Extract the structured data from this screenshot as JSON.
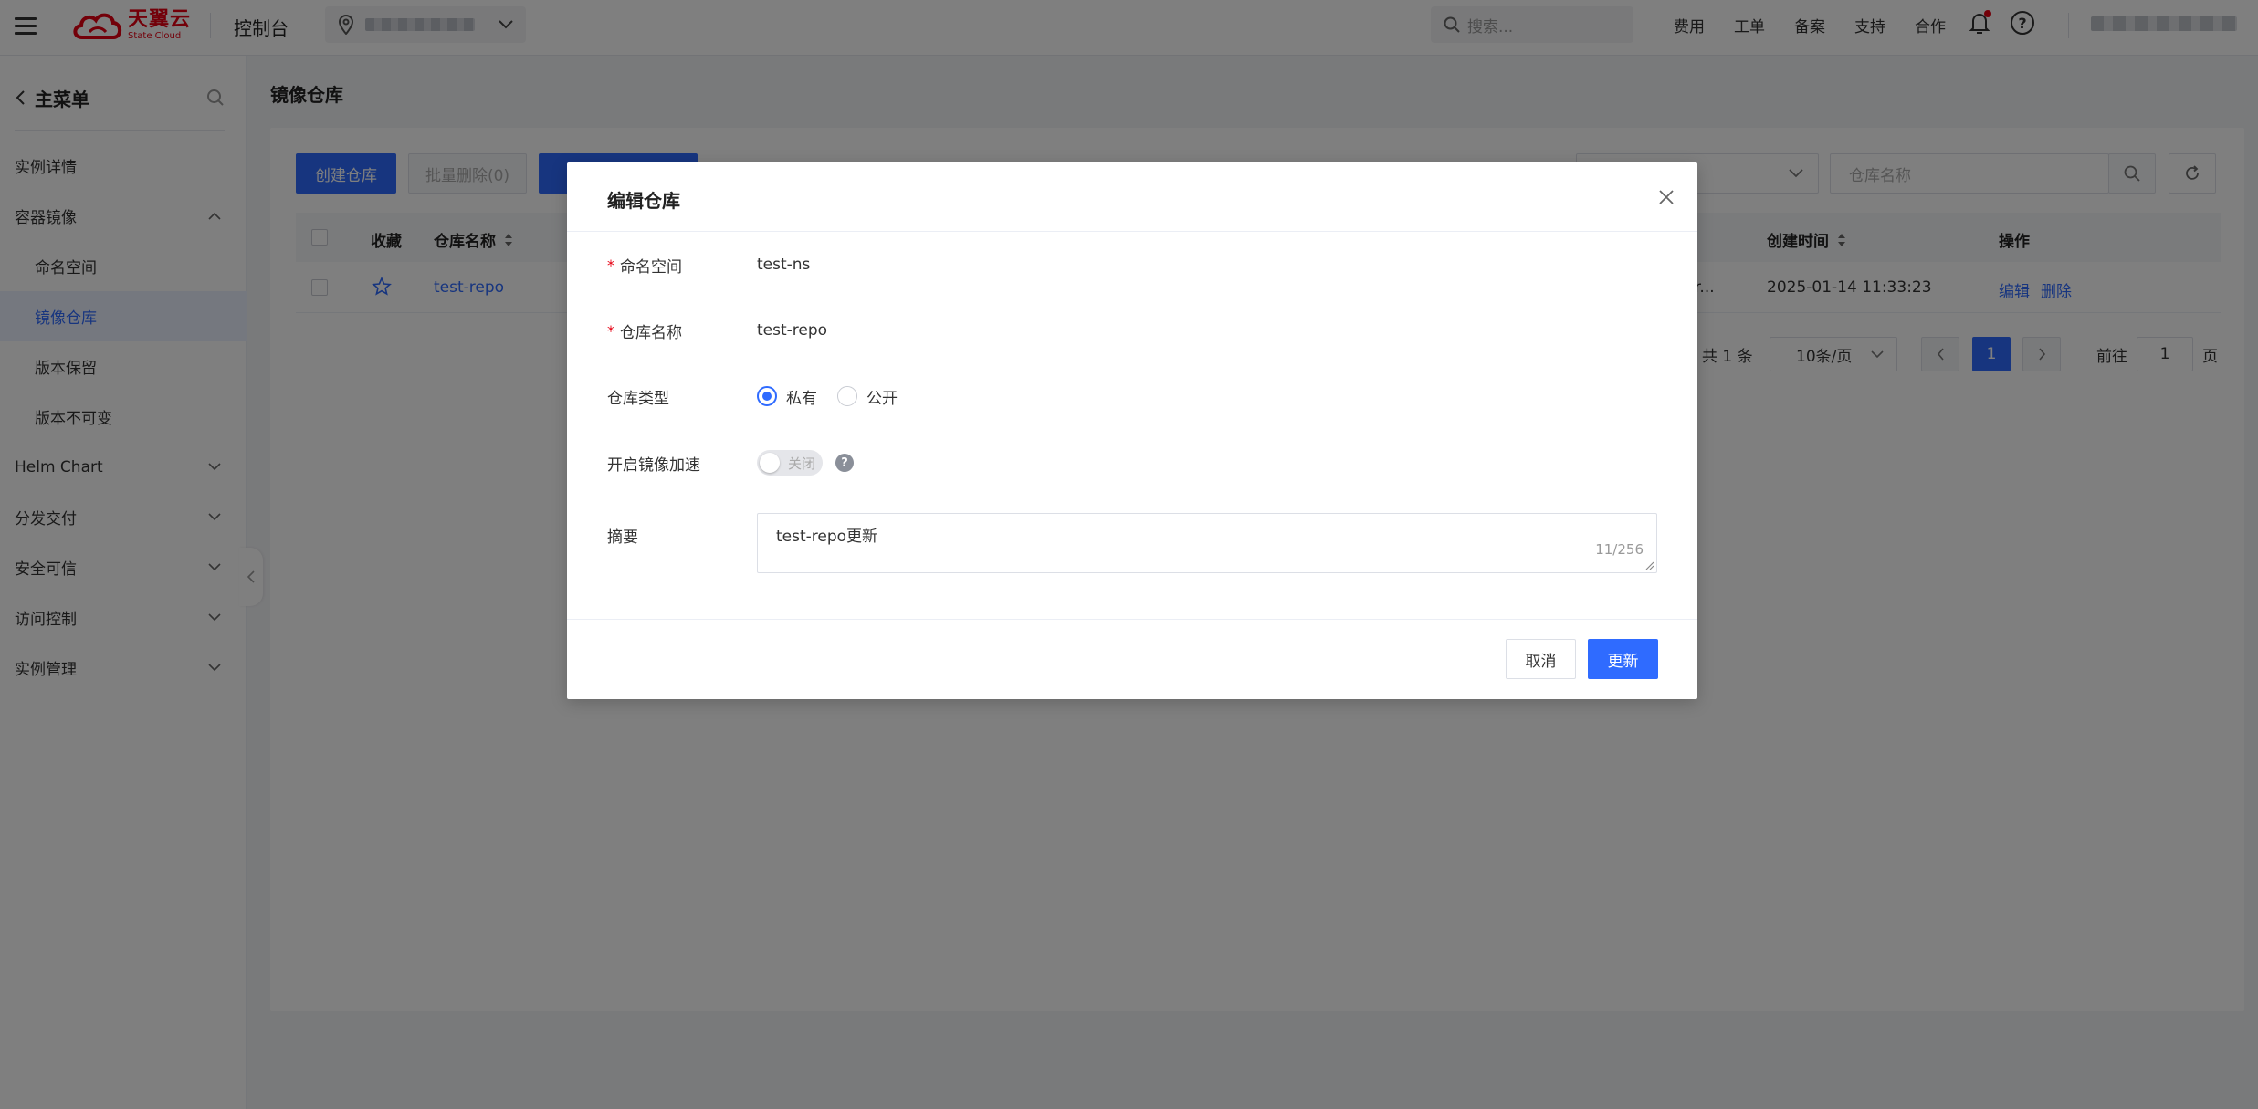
{
  "header": {
    "brand_cn": "天翼云",
    "brand_en": "State Cloud",
    "console": "控制台",
    "search_placeholder": "搜索...",
    "links": [
      "费用",
      "工单",
      "备案",
      "支持",
      "合作"
    ],
    "help": "?"
  },
  "sidebar": {
    "title": "主菜单",
    "items": [
      {
        "label": "实例详情"
      },
      {
        "label": "容器镜像"
      },
      {
        "label": "命名空间"
      },
      {
        "label": "镜像仓库"
      },
      {
        "label": "版本保留"
      },
      {
        "label": "版本不可变"
      },
      {
        "label": "Helm Chart"
      },
      {
        "label": "分发交付"
      },
      {
        "label": "安全可信"
      },
      {
        "label": "访问控制"
      },
      {
        "label": "实例管理"
      }
    ]
  },
  "page": {
    "title": "镜像仓库",
    "create_btn": "创建仓库",
    "batch_delete_btn": "批量删除(0)",
    "repo_search_placeholder": "仓库名称"
  },
  "table": {
    "headers": {
      "favorite": "收藏",
      "name": "仓库名称",
      "created": "创建时间",
      "ops": "操作"
    },
    "row": {
      "name": "test-repo",
      "truncated": "r...",
      "created": "2025-01-14 11:33:23",
      "edit": "编辑",
      "delete": "删除"
    }
  },
  "pagination": {
    "total": "共 1 条",
    "page_size": "10条/页",
    "current_page": "1",
    "goto_label": "前往",
    "goto_value": "1",
    "page_suffix": "页"
  },
  "modal": {
    "title": "编辑仓库",
    "namespace_label": "命名空间",
    "namespace_value": "test-ns",
    "repo_label": "仓库名称",
    "repo_value": "test-repo",
    "type_label": "仓库类型",
    "type_private": "私有",
    "type_public": "公开",
    "accel_label": "开启镜像加速",
    "accel_state": "关闭",
    "accel_help": "?",
    "summary_label": "摘要",
    "summary_value": "test-repo更新",
    "summary_count": "11/256",
    "cancel": "取消",
    "submit": "更新"
  },
  "colors": {
    "primary": "#2f6bff",
    "brand_red": "#e60012"
  }
}
